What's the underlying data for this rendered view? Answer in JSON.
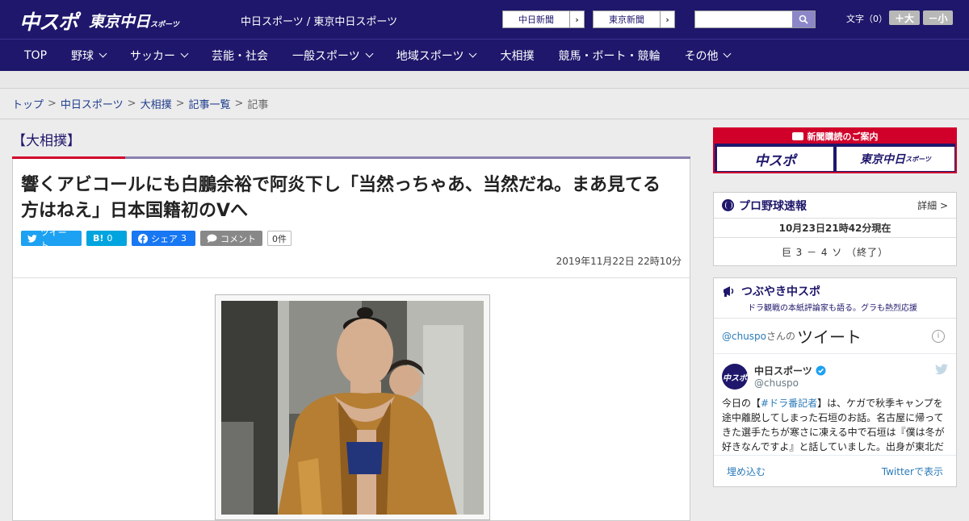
{
  "header": {
    "logo_chunichi": "中スポ",
    "logo_tokyo": "東京中日",
    "logo_tokyo_small": "スポーツ",
    "tagline": "中日スポーツ / 東京中日スポーツ",
    "ext_links": [
      "中日新聞",
      "東京新聞"
    ],
    "font_size_label": "文字（0）",
    "font_larger": "＋大",
    "font_smaller": "－小"
  },
  "nav": {
    "items": [
      {
        "label": "TOP",
        "dropdown": false
      },
      {
        "label": "野球",
        "dropdown": true
      },
      {
        "label": "サッカー",
        "dropdown": true
      },
      {
        "label": "芸能・社会",
        "dropdown": false
      },
      {
        "label": "一般スポーツ",
        "dropdown": true
      },
      {
        "label": "地域スポーツ",
        "dropdown": true
      },
      {
        "label": "大相撲",
        "dropdown": false
      },
      {
        "label": "競馬・ボート・競輪",
        "dropdown": false
      },
      {
        "label": "その他",
        "dropdown": true
      }
    ]
  },
  "breadcrumb": [
    "トップ",
    "中日スポーツ",
    "大相撲",
    "記事一覧",
    "記事"
  ],
  "article": {
    "category": "【大相撲】",
    "headline_line1": "響くアビコールにも白鵬余裕で阿炎下し「当然っちゃあ、当然だね。まあ見てる",
    "headline_line2": "方はねえ」日本国籍初のVへ",
    "social": {
      "tweet": "ツイート",
      "hatena_icon": "B!",
      "hatena_count": "0",
      "share": "シェア",
      "share_count": "3",
      "comment": "コメント",
      "comment_count": "0件"
    },
    "date": "2019年11月22日 22時10分"
  },
  "sidebar": {
    "subscribe_header": "新聞購読のご案内",
    "subscribe_chunichi": "中スポ",
    "subscribe_tokyo": "東京中日",
    "subscribe_tokyo_small": "スポーツ",
    "baseball": {
      "title": "プロ野球速報",
      "more": "詳細 >",
      "timestamp": "10月23日21時42分現在",
      "score": "巨 3 － 4 ソ （終了）"
    },
    "twitter": {
      "title": "つぶやき中スポ",
      "subtitle": "ドラ観戦の本紙評論家も語る。グラも熱烈応援",
      "handle_link": "@chuspo",
      "handle_suffix": "さんの",
      "tweets_word": "ツイート",
      "account_name": "中日スポーツ",
      "account_handle": "@chuspo",
      "avatar_text": "中スポ",
      "body_pre": "今日の【",
      "hashtag": "#ドラ番記者",
      "body_post": "】は、ケガで秋季キャンプを途中離脱してしまった石垣のお話。名古屋に帰ってきた選手たちが寒さに凍える中で石垣は『僕は冬が好きなんですよ』と話していました。出身が東北だ",
      "embed": "埋め込む",
      "view_on_twitter": "Twitterで表示"
    }
  },
  "colors": {
    "brand_navy": "#1e176b",
    "accent_red": "#d0002a",
    "twitter_blue": "#1da1f2",
    "hatena_blue": "#00a4de",
    "facebook_blue": "#1877f2",
    "comment_gray": "#888888"
  }
}
